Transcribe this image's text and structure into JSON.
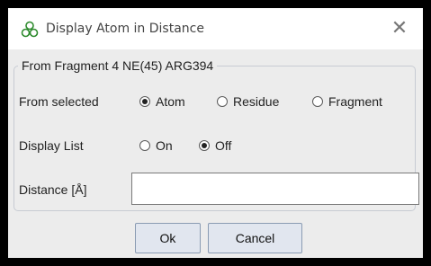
{
  "window": {
    "title": "Display Atom in Distance",
    "title_icon": "molecule-icon",
    "close_glyph": "✕"
  },
  "group": {
    "legend": "From Fragment 4 NE(45) ARG394",
    "from_selected_label": "From selected",
    "from_selected_options": [
      {
        "label": "Atom",
        "selected": true
      },
      {
        "label": "Residue",
        "selected": false
      },
      {
        "label": "Fragment",
        "selected": false
      }
    ],
    "display_list_label": "Display List",
    "display_list_options": [
      {
        "label": "On",
        "selected": false
      },
      {
        "label": "Off",
        "selected": true
      }
    ],
    "distance_label": "Distance [Å]",
    "distance_value": ""
  },
  "buttons": {
    "ok_label": "Ok",
    "cancel_label": "Cancel"
  },
  "colors": {
    "icon_green": "#2e8b2e",
    "button_bg": "#e1e6ef",
    "button_border": "#8a9bb3"
  }
}
